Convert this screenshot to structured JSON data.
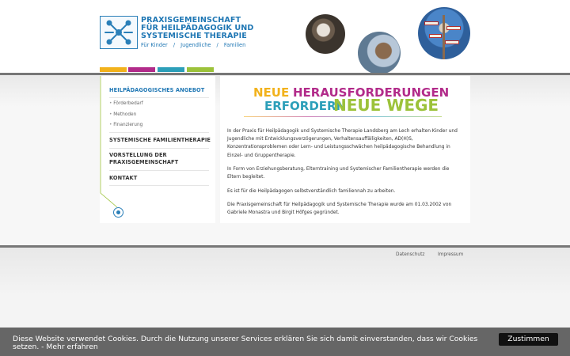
{
  "header": {
    "logo": {
      "line1": "PRAXISGEMEINSCHAFT",
      "line2": "FÜR HEILPÄDAGOGIK UND",
      "line3": "SYSTEMISCHE THERAPIE"
    },
    "tagline": [
      "Für Kinder",
      "/",
      "Jugendliche",
      "/",
      "Familien"
    ]
  },
  "brand_colors": {
    "yellow": "#f2b21c",
    "magenta": "#b22b8a",
    "cyan": "#2c9fb9",
    "green": "#9cc23a",
    "blue": "#1f77b4"
  },
  "sidebar": {
    "items": [
      {
        "label": "HEILPÄDAGOGISCHES ANGEBOT",
        "active": true
      },
      {
        "label": "Förderbedarf"
      },
      {
        "label": "Methoden"
      },
      {
        "label": "Finanzierung"
      },
      {
        "label": "SYSTEMISCHE FAMILIENTHERAPIE"
      },
      {
        "label": "VORSTELLUNG DER PRAXISGEMEINSCHAFT"
      },
      {
        "label": "KONTAKT"
      }
    ]
  },
  "main": {
    "headline": {
      "w1": "NEUE",
      "w2": "HERAUSFORDERUNGEN",
      "w3": "ERFORDERN",
      "w4": "NEUE WEGE"
    },
    "paragraphs": [
      "In der Praxis für Heilpädagogik und Systemische Therapie Landsberg am Lech erhalten Kinder und Jugendliche mit Entwicklungsverzögerungen, Verhaltensauffälligkeiten, AD(H)S, Konzentrationsproblemen oder Lern- und Leistungsschwächen heilpädagogische Behandlung in Einzel- und Gruppentherapie.",
      "In Form von Erziehungsberatung, Elterntraining und Systemischer Familientherapie werden die Eltern begleitet.",
      "Es ist für die Heilpädagogen selbstverständlich familiennah zu arbeiten.",
      "Die Praxisgemeinschaft für Heilpädagogik und Systemische Therapie wurde am 01.03.2002 von Gabriele Monastra und Birgit Höfges gegründet."
    ]
  },
  "footer": {
    "links": [
      "Datenschutz",
      "Impressum"
    ]
  },
  "cookie": {
    "text": "Diese Website verwendet Cookies. Durch die Nutzung unserer Services erklären Sie sich damit einverstanden, dass wir Cookies setzen. - Mehr erfahren",
    "button": "Zustimmen"
  }
}
